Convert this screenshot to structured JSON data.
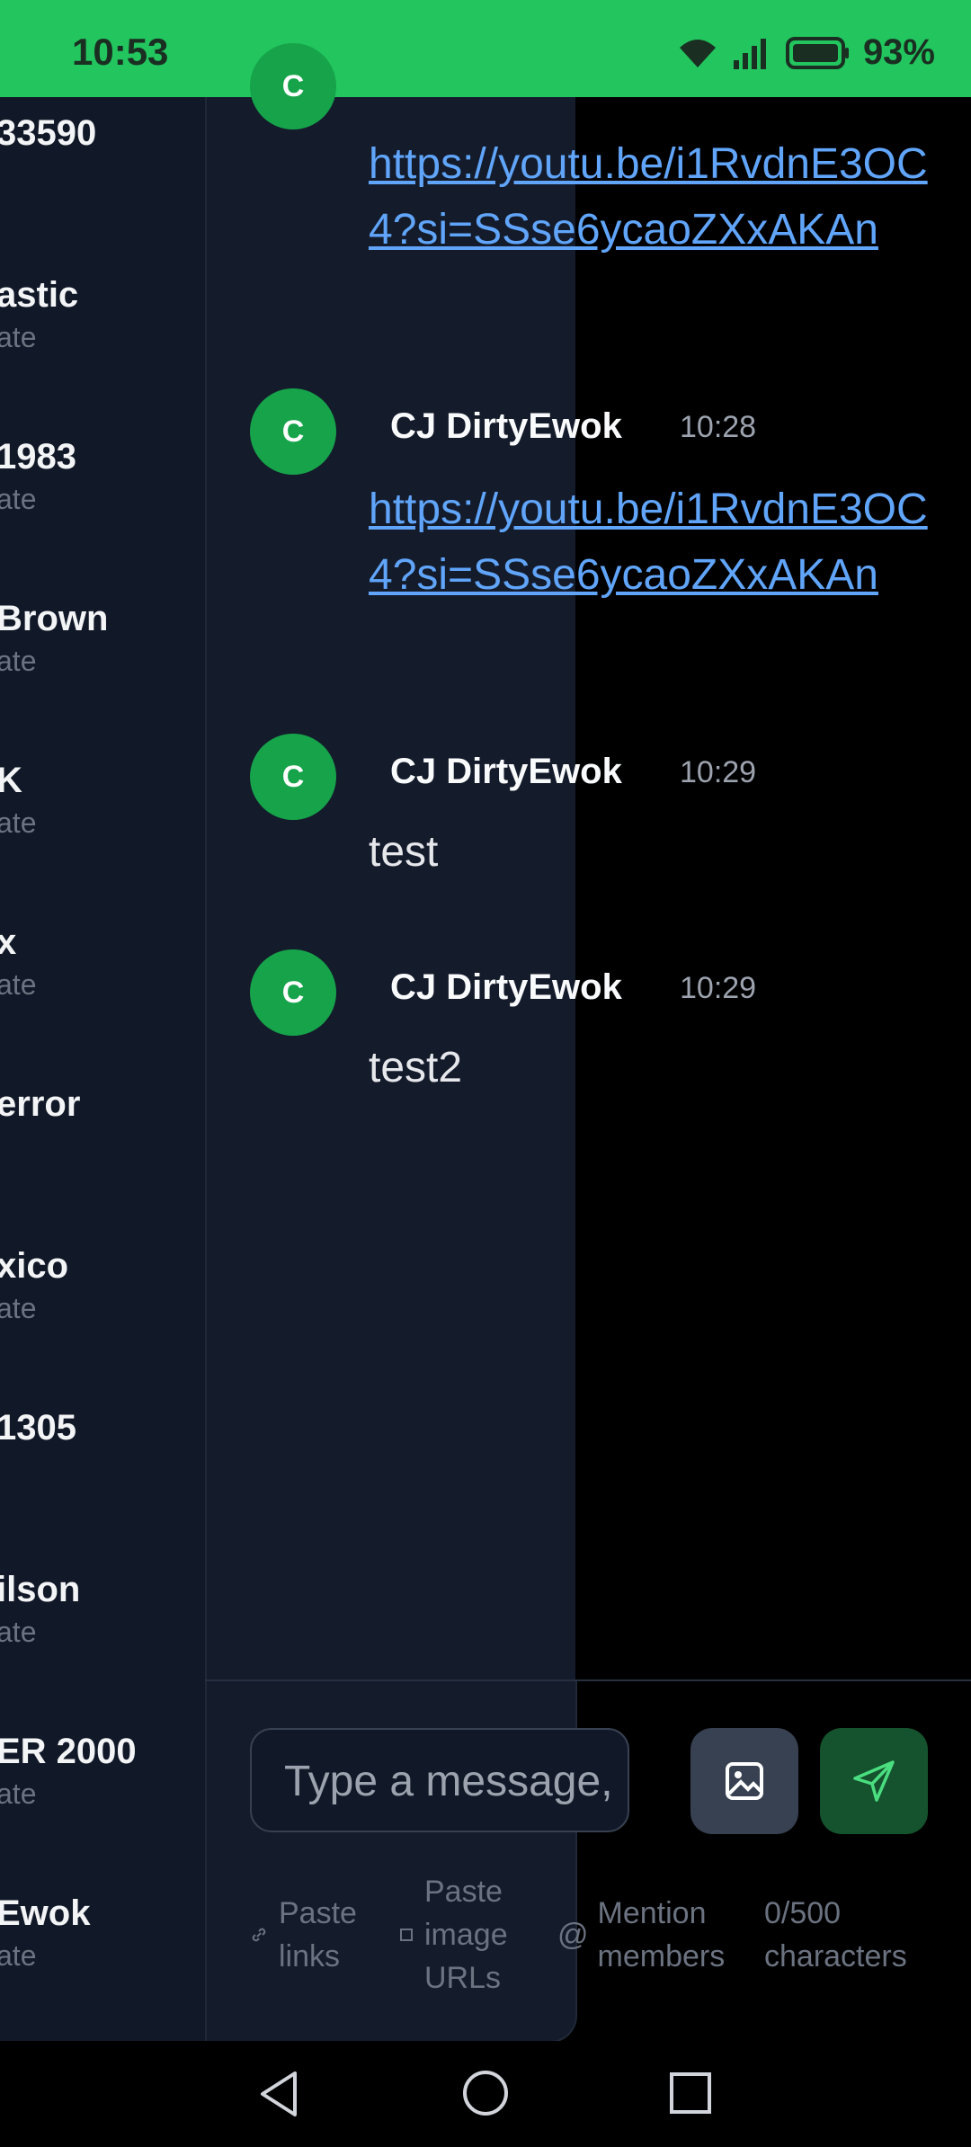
{
  "status_bar": {
    "time": "10:53",
    "battery": "93%"
  },
  "channels": [
    {
      "name": "33590",
      "sub": ""
    },
    {
      "name": "astic",
      "sub": "ate"
    },
    {
      "name": "1983",
      "sub": "ate"
    },
    {
      "name": "Brown",
      "sub": "ate"
    },
    {
      "name": "K",
      "sub": "ate"
    },
    {
      "name": " x",
      "sub": "ate"
    },
    {
      "name": "error",
      "sub": ""
    },
    {
      "name": "xico",
      "sub": "ate"
    },
    {
      "name": "1305",
      "sub": ""
    },
    {
      "name": "ilson",
      "sub": "ate"
    },
    {
      "name": "ER 2000",
      "sub": "ate"
    },
    {
      "name": "Ewok",
      "sub": "ate"
    }
  ],
  "messages": [
    {
      "avatar": "C",
      "author": "",
      "time": "",
      "text": "https://youtu.be/i1RvdnE3OC4?si=SSse6ycaoZXxAKAn",
      "is_link": true
    },
    {
      "avatar": "C",
      "author": "CJ DirtyEwok",
      "time": "10:28",
      "text": "https://youtu.be/i1RvdnE3OC4?si=SSse6ycaoZXxAKAn",
      "is_link": true
    },
    {
      "avatar": "C",
      "author": "CJ DirtyEwok",
      "time": "10:29",
      "text": "test",
      "is_link": false
    },
    {
      "avatar": "C",
      "author": "CJ DirtyEwok",
      "time": "10:29",
      "text": "test2",
      "is_link": false
    }
  ],
  "composer": {
    "placeholder": "Type a message,",
    "hints": {
      "paste_links": "Paste links",
      "paste_image_urls": "Paste image URLs",
      "mention_members": "Mention members",
      "char_count": "0/500 characters"
    }
  },
  "colors": {
    "accent": "#22c55e",
    "avatar": "#16a34a",
    "link": "#60a5fa"
  },
  "icons": [
    "wifi-icon",
    "signal-icon",
    "battery-icon",
    "image-icon",
    "send-icon",
    "link-icon",
    "at-icon",
    "back-nav-icon",
    "home-nav-icon",
    "recents-nav-icon"
  ]
}
